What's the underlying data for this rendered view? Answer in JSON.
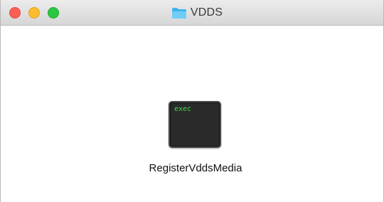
{
  "window": {
    "title": "VDDS",
    "title_icon": "folder-icon",
    "controls": [
      "close",
      "minimize",
      "zoom"
    ]
  },
  "colors": {
    "close": "#fc5f57",
    "minimize": "#fdbc2e",
    "zoom": "#29c840",
    "folder": "#5ac8fa",
    "exec_text": "#3ee045"
  },
  "files": [
    {
      "name": "RegisterVddsMedia",
      "icon": "terminal-exec-icon",
      "icon_text": "exec"
    }
  ]
}
